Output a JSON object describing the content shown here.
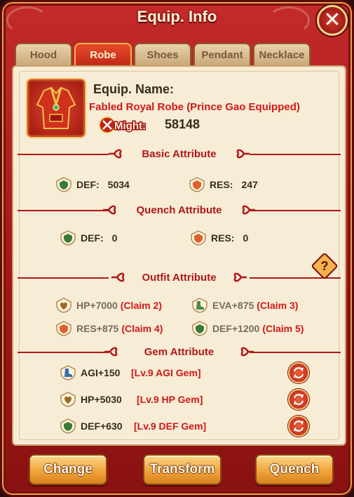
{
  "window": {
    "title": "Equip. Info"
  },
  "tabs": [
    {
      "label": "Hood",
      "active": false
    },
    {
      "label": "Robe",
      "active": true
    },
    {
      "label": "Shoes",
      "active": false
    },
    {
      "label": "Pendant",
      "active": false
    },
    {
      "label": "Necklace",
      "active": false
    }
  ],
  "equip": {
    "name_label": "Equip. Name:",
    "name": "Fabled Royal Robe  (Prince Gao Equipped)",
    "might_label": "Might:",
    "might_value": "58148",
    "icon": "robe-icon"
  },
  "basic": {
    "title": "Basic Attribute",
    "def": {
      "label": "DEF:",
      "value": "5034"
    },
    "res": {
      "label": "RES:",
      "value": "247"
    }
  },
  "quench": {
    "title": "Quench Attribute",
    "def": {
      "label": "DEF:",
      "value": "0"
    },
    "res": {
      "label": "RES:",
      "value": "0"
    }
  },
  "outfit": {
    "title": "Outfit Attribute",
    "help": "?",
    "items": [
      {
        "label": "HP+7000",
        "claim": "(Claim 2)",
        "icon": "heart-icon"
      },
      {
        "label": "EVA+875",
        "claim": "(Claim 3)",
        "icon": "boot-icon"
      },
      {
        "label": "RES+875",
        "claim": "(Claim 4)",
        "icon": "fire-shield-icon"
      },
      {
        "label": "DEF+1200",
        "claim": "(Claim 5)",
        "icon": "shield-icon"
      }
    ]
  },
  "gem": {
    "title": "Gem Attribute",
    "items": [
      {
        "label": "AGI+150",
        "gem": "[Lv.9 AGI Gem]",
        "icon": "boot-icon"
      },
      {
        "label": "HP+5030",
        "gem": "[Lv.9 HP Gem]",
        "icon": "heart-icon"
      },
      {
        "label": "DEF+630",
        "gem": "[Lv.9 DEF Gem]",
        "icon": "shield-icon"
      }
    ]
  },
  "buttons": {
    "change": "Change",
    "transform": "Transform",
    "quench": "Quench"
  },
  "colors": {
    "accent": "#d01818",
    "frame": "#b01e1e",
    "panel": "#f7ecd6",
    "button": "#f0a53a"
  }
}
